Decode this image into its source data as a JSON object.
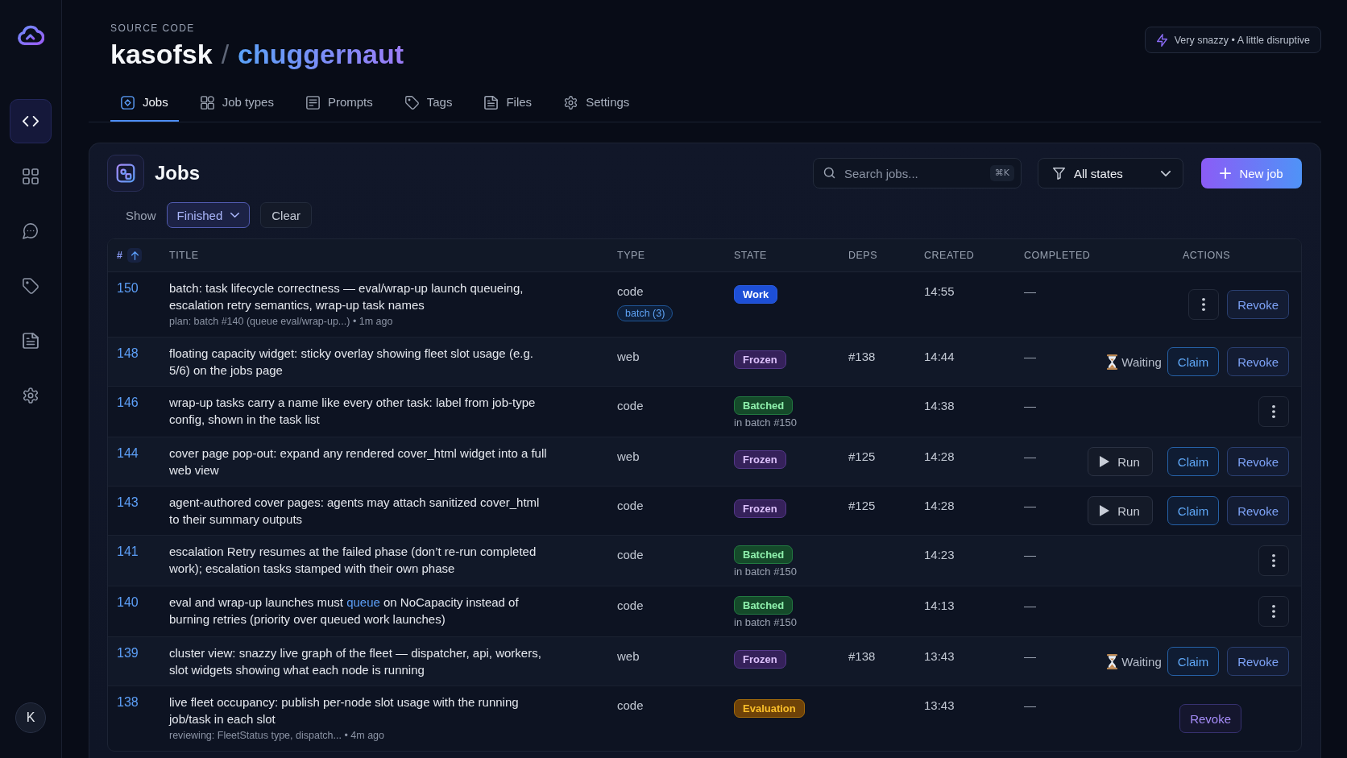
{
  "sidebar": {
    "items": [
      {
        "selected": true
      },
      {
        "selected": false
      },
      {
        "selected": false
      },
      {
        "selected": false
      },
      {
        "selected": false
      },
      {
        "selected": false
      }
    ],
    "avatar": "K"
  },
  "header": {
    "section": "SOURCE CODE",
    "owner": "kasofsk",
    "separator": "/",
    "repo": "chuggernaut",
    "badge": "Very snazzy • A little disruptive"
  },
  "tabs": [
    {
      "label": "Jobs",
      "selected": true
    },
    {
      "label": "Job types",
      "selected": false
    },
    {
      "label": "Prompts",
      "selected": false
    },
    {
      "label": "Tags",
      "selected": false
    },
    {
      "label": "Files",
      "selected": false
    },
    {
      "label": "Settings",
      "selected": false
    }
  ],
  "panel": {
    "title": "Jobs",
    "search": {
      "placeholder": "Search jobs...",
      "shortcut": "⌘K"
    },
    "state_filter": "All states",
    "new_button": "New job",
    "show_label": "Show",
    "show_filter": "Finished",
    "clear_button": "Clear"
  },
  "table": {
    "columns": [
      {
        "label": "#",
        "sorted": true
      },
      {
        "label": "TITLE",
        "sorted": false
      },
      {
        "label": "TYPE",
        "sorted": false
      },
      {
        "label": "STATE",
        "sorted": false
      },
      {
        "label": "DEPS",
        "sorted": false
      },
      {
        "label": "CREATED",
        "sorted": false
      },
      {
        "label": "COMPLETED",
        "sorted": false
      },
      {
        "label": "ACTIONS",
        "sorted": false
      }
    ],
    "rows": [
      {
        "number": "150",
        "title": [
          {
            "kind": "text",
            "text": "batch: task lifecycle correctness — eval/wrap-up launch queueing, escalation retry semantics, wrap-up task names"
          }
        ],
        "meta": "plan: batch #140 (queue eval/wrap-up...) • 1m ago",
        "type": "code",
        "tag": "batch (3)",
        "state": {
          "label": "Work",
          "kind": "work"
        },
        "created": "14:55",
        "completed": "—",
        "actions": [
          {
            "kind": "menu"
          },
          {
            "kind": "revoke",
            "label": "Revoke",
            "accent": false
          }
        ]
      },
      {
        "number": "148",
        "title": [
          {
            "kind": "text",
            "text": "floating capacity widget: sticky overlay showing fleet slot usage (e.g. 5/6) on the jobs page"
          }
        ],
        "type": "web",
        "state": {
          "label": "Frozen",
          "kind": "frozen"
        },
        "deps": "#138",
        "created": "14:44",
        "completed": "—",
        "actions": [
          {
            "kind": "waiting",
            "label": "Waiting"
          },
          {
            "kind": "claim",
            "label": "Claim",
            "accent": false
          },
          {
            "kind": "revoke",
            "label": "Revoke",
            "accent": false
          }
        ]
      },
      {
        "number": "146",
        "title": [
          {
            "kind": "text",
            "text": "wrap-up tasks carry a name like every other task: label from job-type config, shown in the task list"
          }
        ],
        "type": "code",
        "state": {
          "label": "Batched",
          "kind": "batched",
          "note": "in batch #150"
        },
        "created": "14:38",
        "completed": "—",
        "actions": [
          {
            "kind": "menu"
          }
        ]
      },
      {
        "number": "144",
        "title": [
          {
            "kind": "text",
            "text": "cover page pop-out: expand any rendered cover_html widget into a full web view"
          }
        ],
        "type": "web",
        "state": {
          "label": "Frozen",
          "kind": "frozen"
        },
        "deps": "#125",
        "created": "14:28",
        "completed": "—",
        "actions": [
          {
            "kind": "run",
            "label": "Run"
          },
          {
            "kind": "claim",
            "label": "Claim",
            "accent": false
          },
          {
            "kind": "revoke",
            "label": "Revoke",
            "accent": false
          }
        ]
      },
      {
        "number": "143",
        "title": [
          {
            "kind": "text",
            "text": "agent-authored cover pages: agents may attach sanitized cover_html to their summary outputs"
          }
        ],
        "type": "code",
        "state": {
          "label": "Frozen",
          "kind": "frozen"
        },
        "deps": "#125",
        "created": "14:28",
        "completed": "—",
        "actions": [
          {
            "kind": "run",
            "label": "Run"
          },
          {
            "kind": "claim",
            "label": "Claim",
            "accent": false
          },
          {
            "kind": "revoke",
            "label": "Revoke",
            "accent": false
          }
        ]
      },
      {
        "number": "141",
        "title": [
          {
            "kind": "text",
            "text": "escalation Retry resumes at the failed phase (don’t re-run completed work); escalation tasks stamped with their own phase"
          }
        ],
        "type": "code",
        "state": {
          "label": "Batched",
          "kind": "batched",
          "note": "in batch #150"
        },
        "created": "14:23",
        "completed": "—",
        "actions": [
          {
            "kind": "menu"
          }
        ]
      },
      {
        "number": "140",
        "title": [
          {
            "kind": "text",
            "text": "eval and wrap-up launches must "
          },
          {
            "kind": "link",
            "text": "queue"
          },
          {
            "kind": "text",
            "text": " on NoCapacity instead of burning retries (priority over queued work launches)"
          }
        ],
        "type": "code",
        "state": {
          "label": "Batched",
          "kind": "batched",
          "note": "in batch #150"
        },
        "created": "14:13",
        "completed": "—",
        "actions": [
          {
            "kind": "menu"
          }
        ]
      },
      {
        "number": "139",
        "title": [
          {
            "kind": "text",
            "text": "cluster view: snazzy live graph of the fleet — dispatcher, api, workers, slot widgets showing what each node is running"
          }
        ],
        "type": "web",
        "state": {
          "label": "Frozen",
          "kind": "frozen"
        },
        "deps": "#138",
        "created": "13:43",
        "completed": "—",
        "actions": [
          {
            "kind": "waiting",
            "label": "Waiting"
          },
          {
            "kind": "claim",
            "label": "Claim",
            "accent": false
          },
          {
            "kind": "revoke",
            "label": "Revoke",
            "accent": false
          }
        ]
      },
      {
        "number": "138",
        "title": [
          {
            "kind": "text",
            "text": "live fleet occupancy: publish per-node slot usage with the running job/task in each slot"
          }
        ],
        "meta": "reviewing: FleetStatus type, dispatch... • 4m ago",
        "type": "code",
        "state": {
          "label": "Evaluation",
          "kind": "evaluation"
        },
        "created": "13:43",
        "completed": "—",
        "actions": [
          {
            "kind": "revoke",
            "label": "Revoke",
            "accent": true
          }
        ]
      }
    ]
  }
}
